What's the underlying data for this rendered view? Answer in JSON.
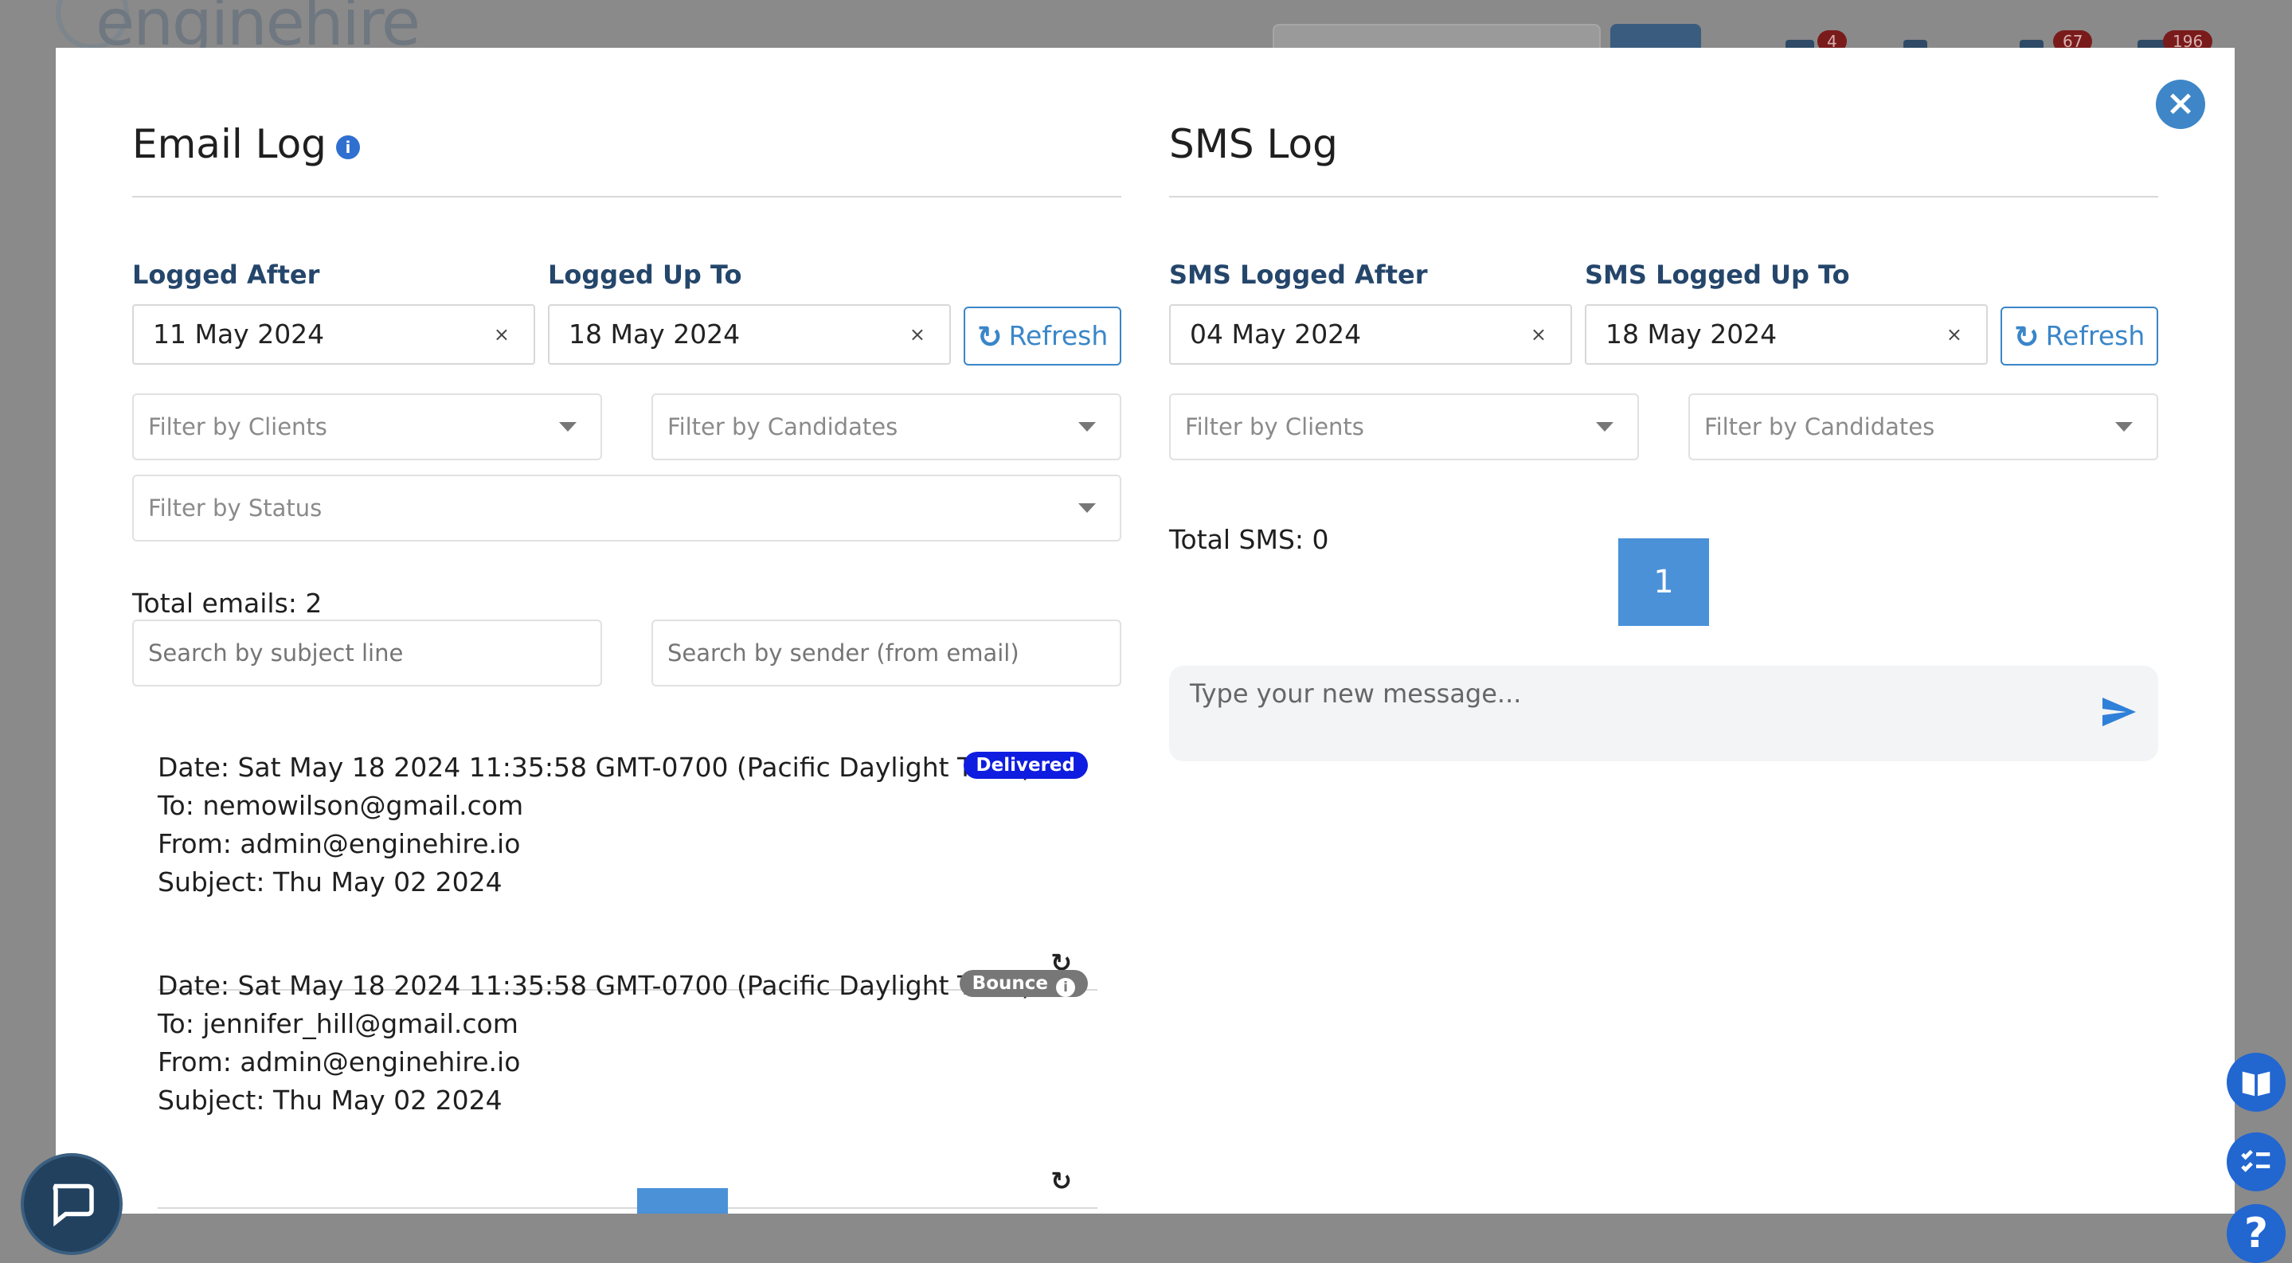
{
  "background": {
    "logo_text": "enginehire",
    "badges": [
      "4",
      "67",
      "196"
    ]
  },
  "modal": {
    "close_label": "×",
    "email_log": {
      "title": "Email Log",
      "info_icon": "info-circle-icon",
      "logged_after_label": "Logged After",
      "logged_after_value": "11 May 2024",
      "logged_up_to_label": "Logged Up To",
      "logged_up_to_value": "18 May 2024",
      "clear_symbol": "×",
      "refresh_label": "Refresh",
      "filter_clients_placeholder": "Filter by Clients",
      "filter_candidates_placeholder": "Filter by Candidates",
      "filter_status_placeholder": "Filter by Status",
      "total_text": "Total emails: 2",
      "search_subject_placeholder": "Search by subject line",
      "search_sender_placeholder": "Search by sender (from email)",
      "emails": [
        {
          "date": "Date: Sat May 18 2024 11:35:58 GMT-0700 (Pacific Daylight Time)",
          "to": "To: nemowilson@gmail.com",
          "from": "From: admin@enginehire.io",
          "subject": "Subject: Thu May 02 2024",
          "status": "Delivered",
          "status_color": "#0f1de0"
        },
        {
          "date": "Date: Sat May 18 2024 11:35:58 GMT-0700 (Pacific Daylight Time)",
          "to": "To: jennifer_hill@gmail.com",
          "from": "From: admin@enginehire.io",
          "subject": "Subject: Thu May 02 2024",
          "status": "Bounce",
          "status_color": "#777777"
        }
      ]
    },
    "sms_log": {
      "title": "SMS Log",
      "logged_after_label": "SMS Logged After",
      "logged_after_value": "04 May 2024",
      "logged_up_to_label": "SMS Logged Up To",
      "logged_up_to_value": "18 May 2024",
      "clear_symbol": "×",
      "refresh_label": "Refresh",
      "filter_clients_placeholder": "Filter by Clients",
      "filter_candidates_placeholder": "Filter by Candidates",
      "total_text": "Total SMS: 0",
      "page_number": "1",
      "message_placeholder": "Type your new message..."
    }
  },
  "colors": {
    "accent": "#3a86c8",
    "label": "#25466b",
    "delivered": "#0f1de0",
    "bounce": "#777777"
  }
}
